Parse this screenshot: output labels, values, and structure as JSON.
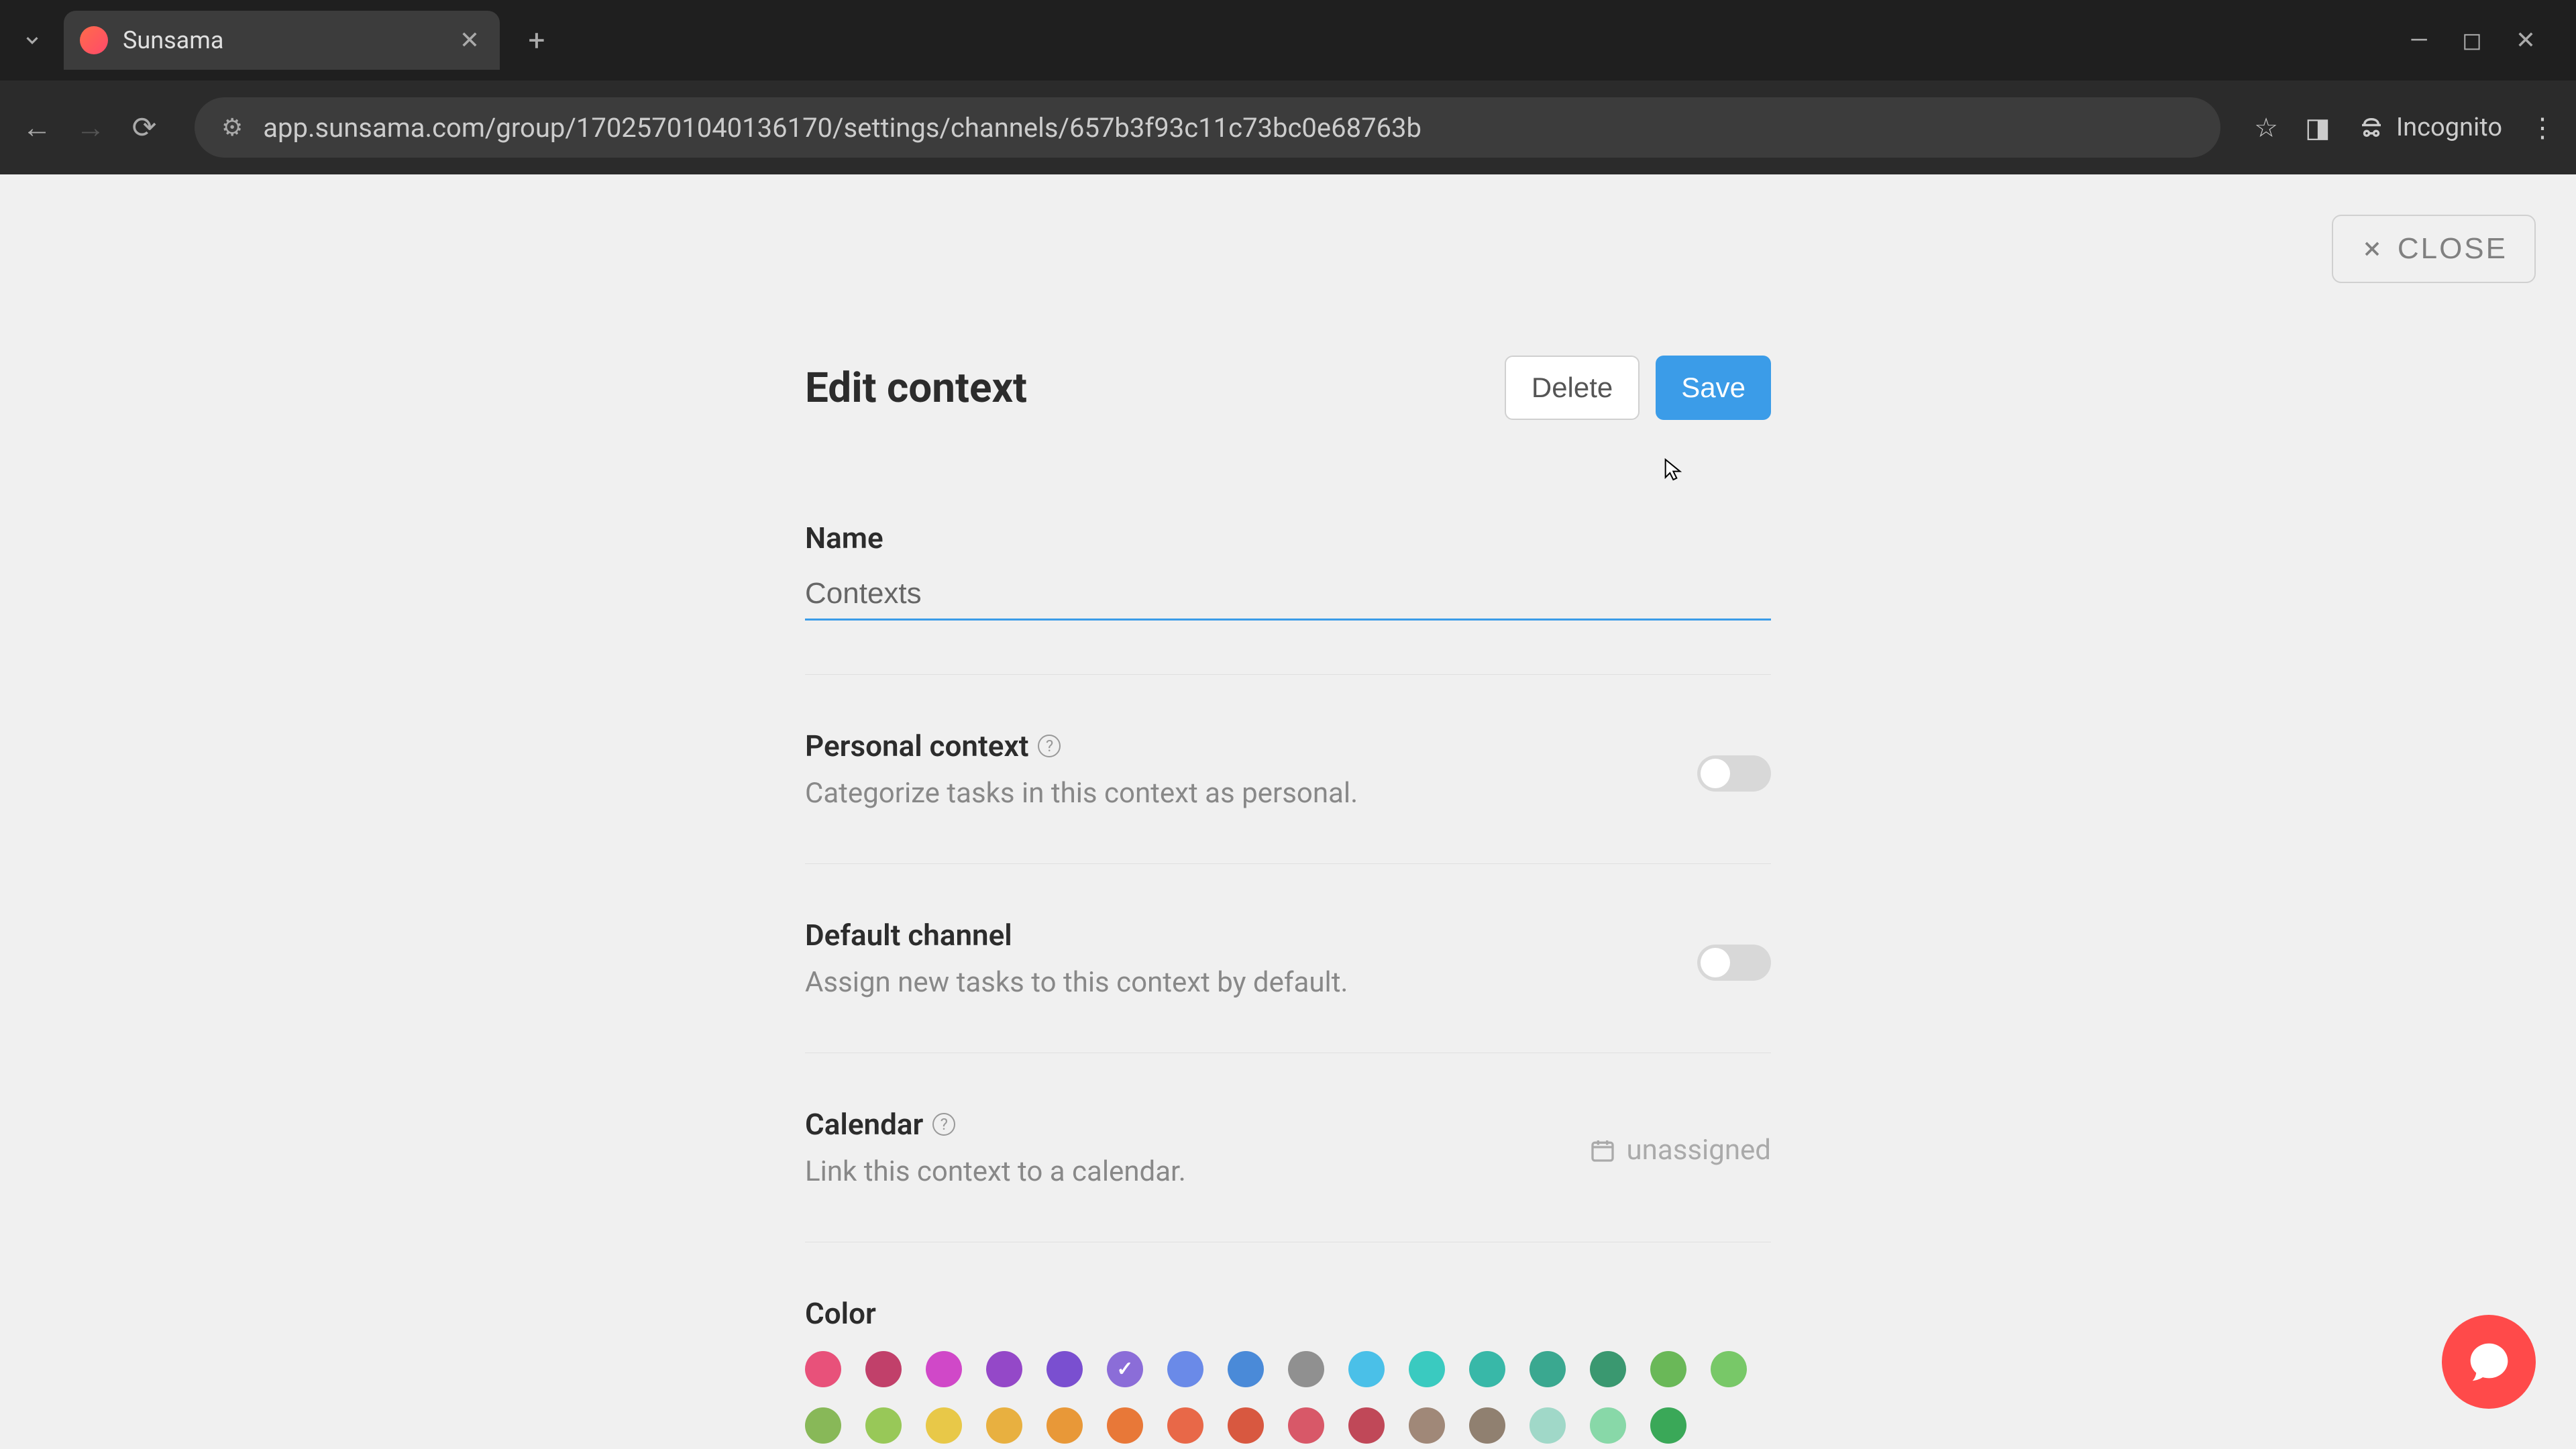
{
  "browser": {
    "tab_title": "Sunsama",
    "url": "app.sunsama.com/group/17025701040136170/settings/channels/657b3f93c11c73bc0e68763b",
    "incognito_label": "Incognito"
  },
  "close_button": "CLOSE",
  "panel": {
    "title": "Edit context",
    "delete_label": "Delete",
    "save_label": "Save"
  },
  "sections": {
    "name": {
      "label": "Name",
      "value": "Contexts"
    },
    "personal": {
      "label": "Personal context",
      "description": "Categorize tasks in this context as personal.",
      "enabled": false
    },
    "default_channel": {
      "label": "Default channel",
      "description": "Assign new tasks to this context by default.",
      "enabled": false
    },
    "calendar": {
      "label": "Calendar",
      "description": "Link this context to a calendar.",
      "value": "unassigned"
    },
    "color": {
      "label": "Color",
      "selected_index": 5,
      "row1": [
        "#e8517a",
        "#c1406a",
        "#d048c8",
        "#9448c8",
        "#7a4fd0",
        "#8b6dd8",
        "#6a8ae8",
        "#4a8ad8",
        "#909090",
        "#4ac0e8",
        "#3acac0",
        "#38b8a8",
        "#3aa890",
        "#3a9870",
        "#6ab858",
        "#78c868"
      ],
      "row2": [
        "#88b858",
        "#98c858",
        "#e8c848",
        "#e8b040",
        "#e89838",
        "#e87838",
        "#e86848",
        "#d85840",
        "#d85868",
        "#c04858",
        "#a08878",
        "#908070",
        "#a0d8c8",
        "#88d8a8",
        "#3aa858"
      ]
    }
  }
}
